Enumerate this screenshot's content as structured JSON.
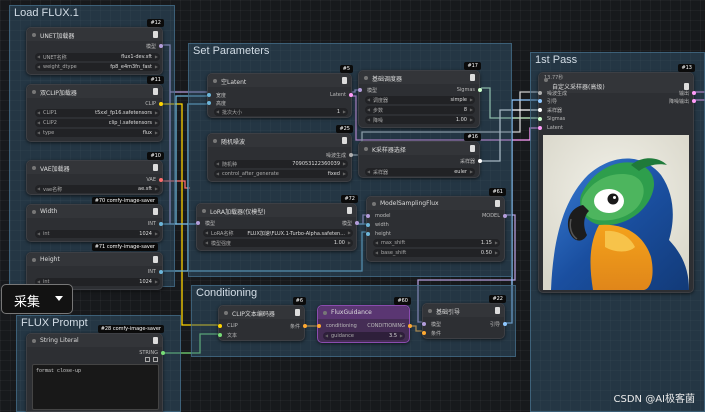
{
  "groups": {
    "load": "Load FLUX.1",
    "set_params": "Set Parameters",
    "first_pass": "1st Pass",
    "conditioning": "Conditioning",
    "prompt": "FLUX Prompt"
  },
  "nodes": {
    "unet": {
      "title": "UNET加载器",
      "id": "#12",
      "out": "模型",
      "w1_label": "UNET名称",
      "w1_value": "flux1-dev.sft",
      "w2_label": "weight_dtype",
      "w2_value": "fp8_e4m3fn_fast"
    },
    "clip": {
      "title": "双CLIP加载器",
      "id": "#11",
      "out": "CLIP",
      "w1_label": "CLIP1",
      "w1_value": "t5xxl_fp16.safetensors",
      "w2_label": "CLIP2",
      "w2_value": "clip_l.safetensors",
      "w3_label": "type",
      "w3_value": "flux"
    },
    "vae": {
      "title": "VAE加载器",
      "id": "#10",
      "out": "VAE",
      "w1_label": "vae名称",
      "w1_value": "ae.sft",
      "tag": "#70 comfy-image-saver"
    },
    "width": {
      "title": "Width",
      "out": "INT",
      "w_label": "int",
      "w_value": "1024",
      "tag": "#71 comfy-image-saver"
    },
    "height": {
      "title": "Height",
      "out": "INT",
      "w_label": "int",
      "w_value": "1024"
    },
    "latent": {
      "title": "空Latent",
      "id": "#5",
      "in1": "宽度",
      "in2": "高度",
      "out": "Latent",
      "w_label": "批次大小",
      "w_value": "1"
    },
    "scheduler": {
      "title": "基础调度器",
      "id": "#17",
      "in1": "模型",
      "out": "Sigmas",
      "w1_label": "调度器",
      "w1_value": "simple",
      "w2_label": "步数",
      "w2_value": "8",
      "w3_label": "降噪",
      "w3_value": "1.00"
    },
    "noise": {
      "title": "随机噪波",
      "id": "#25",
      "out": "噪波生成",
      "w1_label": "随机种",
      "w1_value": "709053122360039",
      "w2_label": "control_after_generate",
      "w2_value": "fixed"
    },
    "ksampler_select": {
      "title": "K采样器选择",
      "id": "#16",
      "out": "采样器",
      "w_label": "采样器",
      "w_value": "euler"
    },
    "lora": {
      "title": "LoRA加载器(仅模型)",
      "id": "#72",
      "in1": "模型",
      "out": "模型",
      "w1_label": "LoRA名称",
      "w1_value": "FLUX加速\\FLUX.1-Turbo-Alpha.safeten...",
      "w2_label": "模型强度",
      "w2_value": "1.00"
    },
    "model_sampling": {
      "title": "ModelSamplingFlux",
      "id": "#61",
      "in1": "model",
      "in2": "width",
      "in3": "height",
      "out": "MODEL",
      "w1_label": "max_shift",
      "w1_value": "1.15",
      "w2_label": "base_shift",
      "w2_value": "0.50"
    },
    "custom_sampler": {
      "title": "自定义采样器(高级)",
      "id": "#13",
      "time": "13.77秒",
      "in1": "噪波生成",
      "in2": "引导",
      "in3": "采样器",
      "in4": "Sigmas",
      "in5": "Latent",
      "out1": "输出",
      "out2": "降噪输出"
    },
    "clip_encode": {
      "title": "CLIP文本编码器",
      "id": "#6",
      "in1": "CLIP",
      "in2": "文本",
      "out": "条件"
    },
    "flux_guidance": {
      "title": "FluxGuidance",
      "id": "#60",
      "in1": "conditioning",
      "out": "CONDITIONING",
      "w_label": "guidance",
      "w_value": "3.5"
    },
    "basic_guider": {
      "title": "基础引导",
      "id": "#22",
      "in1": "模型",
      "in2": "条件",
      "out": "引导"
    },
    "string_literal": {
      "title": "String Literal",
      "id": "#28 comfy-image-saver",
      "out": "STRING",
      "text": "format close-up"
    }
  },
  "dropdown_label": "采集",
  "watermark": "CSDN @AI极客菌",
  "colors": {
    "model": "#b39ddb",
    "clip": "#ffd500",
    "vae": "#ff6e6e",
    "int": "#6cb5d9",
    "latent": "#ff9cf9",
    "conditioning": "#ffa931",
    "sigmas": "#cdffcd",
    "noise": "#b0b0b0"
  }
}
